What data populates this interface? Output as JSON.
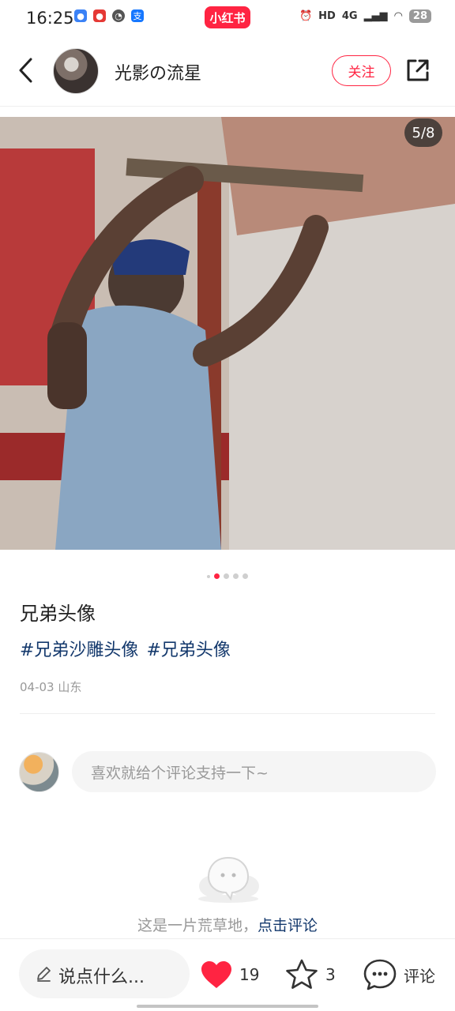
{
  "status_bar": {
    "time": "16:25",
    "brand": "小红书",
    "network": "4G",
    "battery": "28"
  },
  "header": {
    "username": "光影の流星",
    "follow_label": "关注"
  },
  "photo": {
    "counter": "5/8"
  },
  "carousel": {
    "total": 5,
    "active_index": 1
  },
  "post": {
    "title": "兄弟头像",
    "tags": [
      "#兄弟沙雕头像",
      "#兄弟头像"
    ],
    "meta": "04-03 山东"
  },
  "comment_input": {
    "placeholder": "喜欢就给个评论支持一下~"
  },
  "empty_state": {
    "text": "这是一片荒草地，",
    "link": "点击评论"
  },
  "bottom_bar": {
    "say_label": "说点什么...",
    "likes": "19",
    "collects": "3",
    "comment_label": "评论"
  },
  "colors": {
    "brand": "#ff2442",
    "tag": "#13386c",
    "muted": "#999999"
  }
}
